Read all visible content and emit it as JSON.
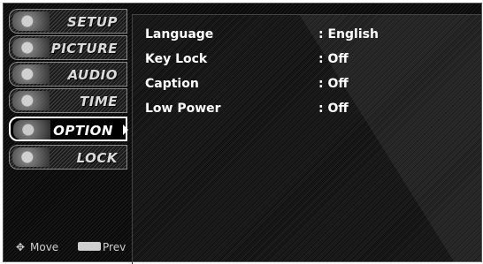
{
  "menu": {
    "items": [
      {
        "label": "SETUP",
        "active": false
      },
      {
        "label": "PICTURE",
        "active": false
      },
      {
        "label": "AUDIO",
        "active": false
      },
      {
        "label": "TIME",
        "active": false
      },
      {
        "label": "OPTION",
        "active": true
      },
      {
        "label": "LOCK",
        "active": false
      }
    ]
  },
  "footer": {
    "move_label": "Move",
    "prev_label": "Prev"
  },
  "options": [
    {
      "name": "Language",
      "value": ": English"
    },
    {
      "name": "Key Lock",
      "value": ": Off"
    },
    {
      "name": "Caption",
      "value": ": Off"
    },
    {
      "name": "Low Power",
      "value": ": Off"
    }
  ]
}
